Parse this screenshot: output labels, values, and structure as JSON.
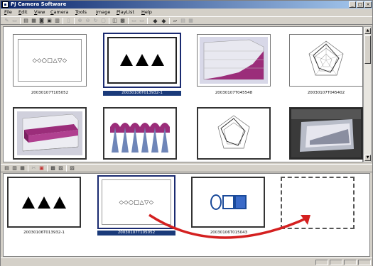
{
  "window": {
    "title": "PJ Camera Software"
  },
  "menu": [
    "File",
    "Edit",
    "View",
    "Camera",
    "Tools",
    "Image",
    "PlayList",
    "Help"
  ],
  "title_buttons": [
    "_",
    "□",
    "×"
  ],
  "toolbar_icons": [
    "select-icon",
    "copy-icon",
    "paste-icon",
    "thumbs-icon",
    "camera-icon",
    "settings-icon",
    "save-icon",
    "zoom-in-icon",
    "zoom-out-icon",
    "rotate-icon",
    "crop-icon",
    "compare-icon",
    "grid-icon",
    "prev-icon",
    "next-icon",
    "folder-icon",
    "print-icon",
    "properties-icon"
  ],
  "upper_thumbnails": [
    {
      "caption": "20030107T105052",
      "kind": "shapes-row"
    },
    {
      "caption": "20030106T013932-1",
      "kind": "triangles",
      "selected": true
    },
    {
      "caption": "20030107T045548",
      "kind": "area-chart"
    },
    {
      "caption": "20030107T045402",
      "kind": "radar-chart"
    },
    {
      "caption": "",
      "kind": "bar3d-chart"
    },
    {
      "caption": "",
      "kind": "cones"
    },
    {
      "caption": "",
      "kind": "radar-chart"
    },
    {
      "caption": "",
      "kind": "photo-screen"
    }
  ],
  "lower_thumbnails": [
    {
      "caption": "20030106T013932-1",
      "kind": "triangles"
    },
    {
      "caption": "20030107T105052",
      "kind": "shapes-row",
      "selected": true
    },
    {
      "caption": "20030106T015043",
      "kind": "circle-squares"
    }
  ],
  "shapes_text": "◇◇○□△▽◇",
  "colors": {
    "selection": "#1a3a7a",
    "title_start": "#0a246a",
    "arrow": "#d42020",
    "chart_magenta": "#9b2d7a"
  }
}
